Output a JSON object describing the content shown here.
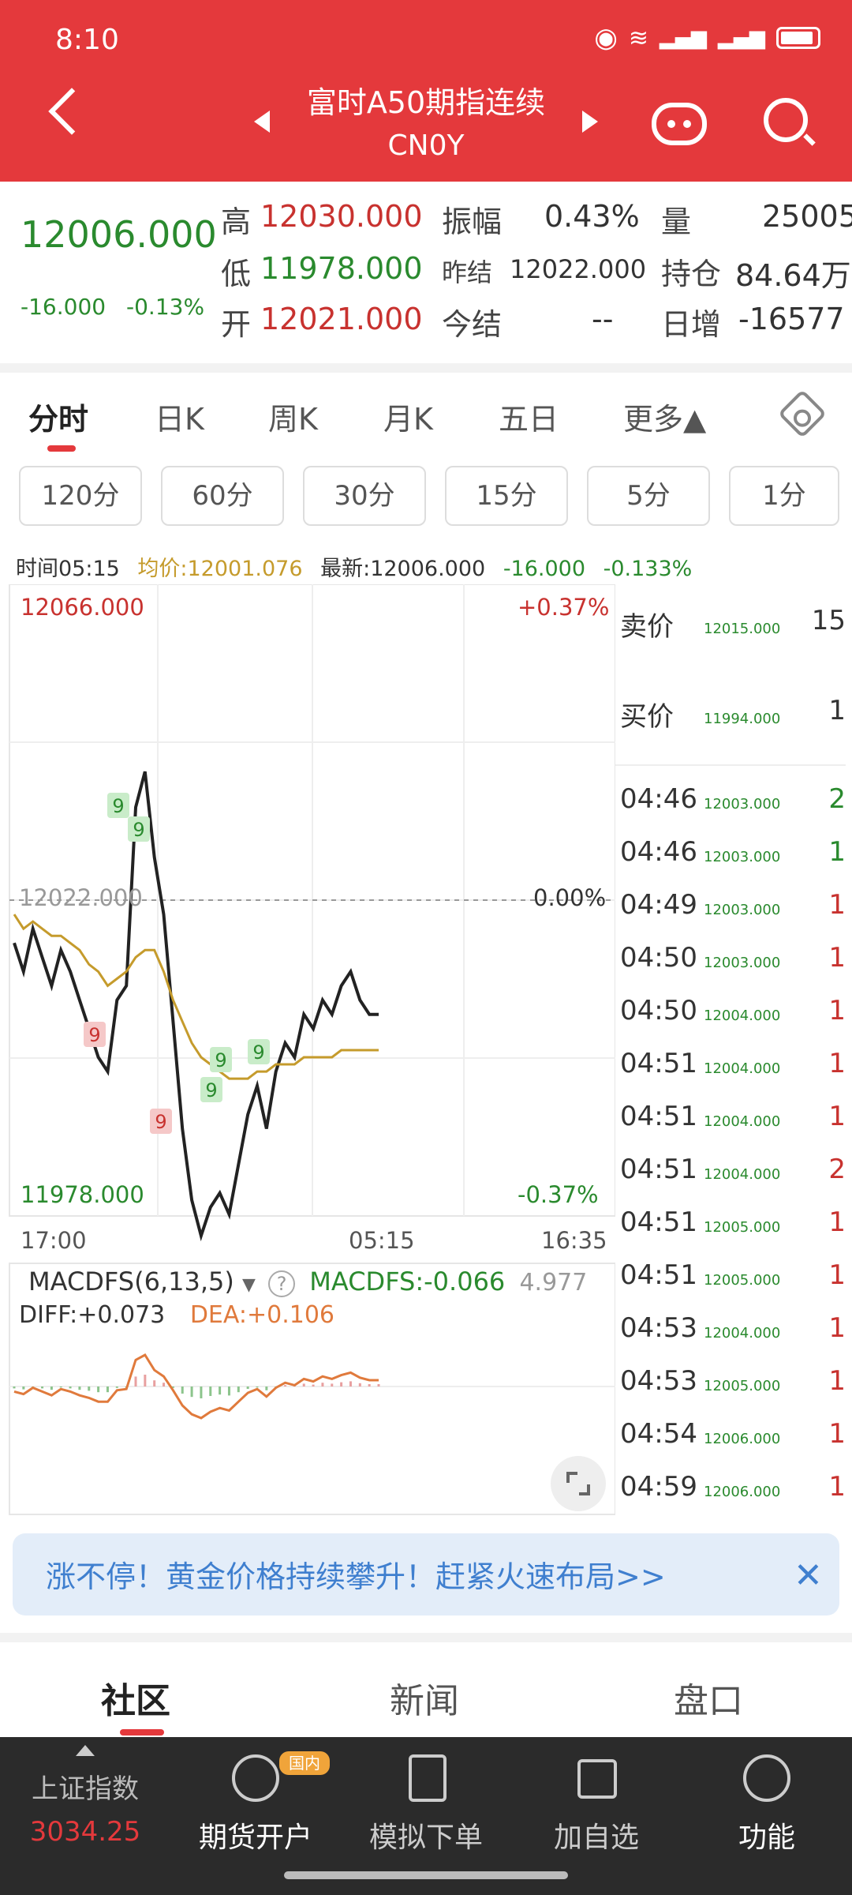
{
  "status": {
    "time": "8:10"
  },
  "header": {
    "title": "富时A50期指连续",
    "code": "CN0Y"
  },
  "quote": {
    "last": "12006.000",
    "change": "-16.000",
    "change_pct": "-0.13%",
    "high_label": "高",
    "high": "12030.000",
    "low_label": "低",
    "low": "11978.000",
    "open_label": "开",
    "open": "12021.000",
    "amp_label": "振幅",
    "amp": "0.43%",
    "prev_label": "昨结",
    "prev": "12022.000",
    "today_label": "今结",
    "today": "--",
    "vol_label": "量",
    "vol": "25005",
    "oi_label": "持仓",
    "oi": "84.64万",
    "daily_label": "日增",
    "daily": "-16577"
  },
  "tabs": [
    "分时",
    "日K",
    "周K",
    "月K",
    "五日",
    "更多▲"
  ],
  "intervals": [
    "120分",
    "60分",
    "30分",
    "15分",
    "5分",
    "1分"
  ],
  "info": {
    "time": "时间05:15",
    "avg": "均价:12001.076",
    "latest": "最新:12006.000",
    "chg": "-16.000",
    "pct": "-0.133%"
  },
  "chart_axes": {
    "y_top": "12066.000",
    "y_bottom": "11978.000",
    "pct_top": "+0.37%",
    "pct_mid": "0.00%",
    "pct_bottom": "-0.37%",
    "ref": "12022.000",
    "x_start": "17:00",
    "x_mid": "05:15",
    "x_end": "16:35",
    "markers": [
      "9",
      "9",
      "9",
      "9",
      "9",
      "9",
      "9"
    ]
  },
  "chart_data": {
    "type": "line",
    "series": [
      {
        "values": [
          12016,
          12012,
          12018,
          12014,
          12010,
          12015,
          12012,
          12008,
          12004,
          12000,
          11998,
          12008,
          12010,
          12035,
          12040,
          12028,
          12020,
          12005,
          11990,
          11980,
          11975,
          11979,
          11981,
          11978,
          11985,
          11992,
          11996,
          11990,
          11998,
          12002,
          12000,
          12006,
          12004,
          12008,
          12006,
          12010,
          12012,
          12008,
          12006,
          12006
        ]
      },
      {
        "values": [
          12020,
          12018,
          12019,
          12018,
          12017,
          12017,
          12016,
          12015,
          12013,
          12012,
          12010,
          12011,
          12012,
          12014,
          12015,
          12015,
          12012,
          12008,
          12005,
          12002,
          12000,
          11999,
          11998,
          11997,
          11997,
          11997,
          11998,
          11998,
          11999,
          11999,
          11999,
          12000,
          12000,
          12000,
          12000,
          12001,
          12001,
          12001,
          12001,
          12001
        ]
      }
    ],
    "ylim": [
      11978,
      12066
    ]
  },
  "orders": {
    "sell_label": "卖价",
    "sell_price": "12015.000",
    "sell_vol": "15",
    "buy_label": "买价",
    "buy_price": "11994.000",
    "buy_vol": "1",
    "trades": [
      {
        "t": "04:46",
        "p": "12003.000",
        "v": "2",
        "up": false
      },
      {
        "t": "04:46",
        "p": "12003.000",
        "v": "1",
        "up": false
      },
      {
        "t": "04:49",
        "p": "12003.000",
        "v": "1",
        "up": true
      },
      {
        "t": "04:50",
        "p": "12003.000",
        "v": "1",
        "up": true
      },
      {
        "t": "04:50",
        "p": "12004.000",
        "v": "1",
        "up": true
      },
      {
        "t": "04:51",
        "p": "12004.000",
        "v": "1",
        "up": true
      },
      {
        "t": "04:51",
        "p": "12004.000",
        "v": "1",
        "up": true
      },
      {
        "t": "04:51",
        "p": "12004.000",
        "v": "2",
        "up": true
      },
      {
        "t": "04:51",
        "p": "12005.000",
        "v": "1",
        "up": true
      },
      {
        "t": "04:51",
        "p": "12005.000",
        "v": "1",
        "up": true
      },
      {
        "t": "04:53",
        "p": "12004.000",
        "v": "1",
        "up": true
      },
      {
        "t": "04:53",
        "p": "12005.000",
        "v": "1",
        "up": true
      },
      {
        "t": "04:54",
        "p": "12006.000",
        "v": "1",
        "up": true
      },
      {
        "t": "04:59",
        "p": "12006.000",
        "v": "1",
        "up": true
      }
    ]
  },
  "macd": {
    "name": "MACDFS(6,13,5)",
    "help": "?",
    "value": "MACDFS:-0.066",
    "max": "4.977",
    "diff": "DIFF:+0.073",
    "dea": "DEA:+0.106"
  },
  "banner": {
    "text": "涨不停！黄金价格持续攀升！赶紧火速布局>>",
    "close": "✕"
  },
  "sections": [
    "社区",
    "新闻",
    "盘口"
  ],
  "bottom": {
    "index_name": "上证指数",
    "index_value": "3034.25",
    "badge": "国内",
    "items": [
      "期货开户",
      "模拟下单",
      "加自选",
      "功能"
    ]
  },
  "colors": {
    "header": "#e4393c",
    "up": "#c8322f",
    "down": "#2a8a2e",
    "avg": "#c59b2c"
  }
}
